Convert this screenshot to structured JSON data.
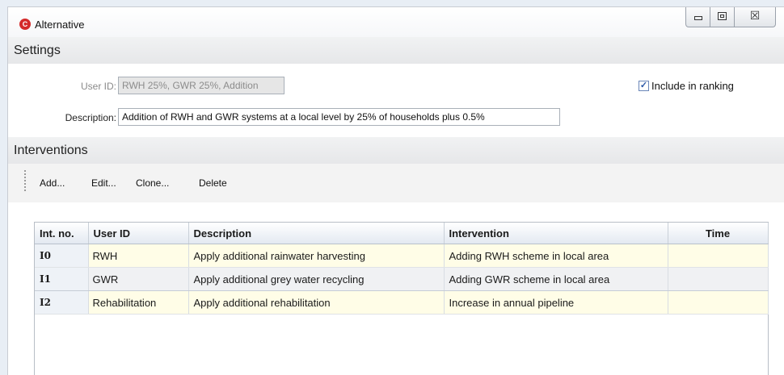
{
  "window": {
    "title": "Alternative",
    "close_symbol": "☒"
  },
  "settings": {
    "header": "Settings",
    "user_id_label": "User ID:",
    "user_id_value": "RWH 25%, GWR 25%, Addition",
    "description_label": "Description:",
    "description_value": "Addition of RWH and GWR systems at a local level by 25% of households plus 0.5%",
    "include_in_ranking_label": "Include in ranking",
    "include_in_ranking_checked": true,
    "checkmark": "✓"
  },
  "interventions": {
    "header": "Interventions",
    "toolbar": {
      "add": "Add...",
      "edit": "Edit...",
      "clone": "Clone...",
      "delete": "Delete"
    },
    "columns": [
      "Int. no.",
      "User ID",
      "Description",
      "Intervention",
      "Time"
    ],
    "rows": [
      {
        "int_no": "I0",
        "user_id": "RWH",
        "description": "Apply additional rainwater harvesting",
        "intervention": "Adding RWH scheme in local area",
        "time": ""
      },
      {
        "int_no": "I1",
        "user_id": "GWR",
        "description": "Apply additional grey water recycling",
        "intervention": "Adding GWR scheme in local area",
        "time": ""
      },
      {
        "int_no": "I2",
        "user_id": "Rehabilitation",
        "description": "Apply additional rehabilitation",
        "intervention": "Increase in annual pipeline",
        "time": ""
      }
    ]
  },
  "colors": {
    "row_highlight": "#fffde7",
    "row_selected": "#f0f1f3",
    "app_icon": "#d42a2a",
    "checkbox_check": "#2a57a6"
  }
}
